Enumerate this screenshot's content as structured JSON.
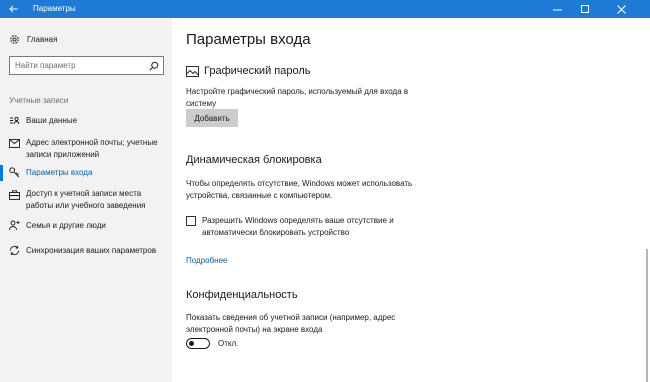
{
  "window": {
    "title": "Параметры",
    "controls": {
      "minimize": "–",
      "maximize": "☐",
      "close": "✕"
    }
  },
  "sidebar": {
    "home_label": "Главная",
    "search_placeholder": "Найти параметр",
    "section_title": "Учетные записи",
    "items": [
      {
        "label": "Ваши данные",
        "icon": "person-card-icon",
        "active": false
      },
      {
        "label": "Адрес электронной почты; учетные записи приложений",
        "icon": "mail-icon",
        "active": false
      },
      {
        "label": "Параметры входа",
        "icon": "key-icon",
        "active": true
      },
      {
        "label": "Доступ к учетной записи места работы или учебного заведения",
        "icon": "briefcase-icon",
        "active": false
      },
      {
        "label": "Семья и другие люди",
        "icon": "people-add-icon",
        "active": false
      },
      {
        "label": "Синхронизация ваших параметров",
        "icon": "sync-icon",
        "active": false
      }
    ]
  },
  "main": {
    "title": "Параметры входа",
    "picture_password": {
      "heading": "Графический пароль",
      "description": "Настройте графический пароль, используемый для входа в систему",
      "button_label": "Добавить"
    },
    "dynamic_lock": {
      "heading": "Динамическая блокировка",
      "description": "Чтобы определять отсутствие, Windows может использовать устройства, связанные с компьютером.",
      "checkbox_label": "Разрешить Windows определять ваше отсутствие и автоматически блокировать устройство",
      "checkbox_checked": false,
      "link_label": "Подробнее"
    },
    "privacy": {
      "heading": "Конфиденциальность",
      "description": "Показать сведения об учетной записи (например, адрес электронной почты) на экране входа",
      "toggle_label": "Откл.",
      "toggle_on": false
    }
  },
  "colors": {
    "titlebar": "#1e7ad4",
    "accent": "#0078d7",
    "link": "#0063b1",
    "sidebar_bg": "#f2f2f2"
  }
}
